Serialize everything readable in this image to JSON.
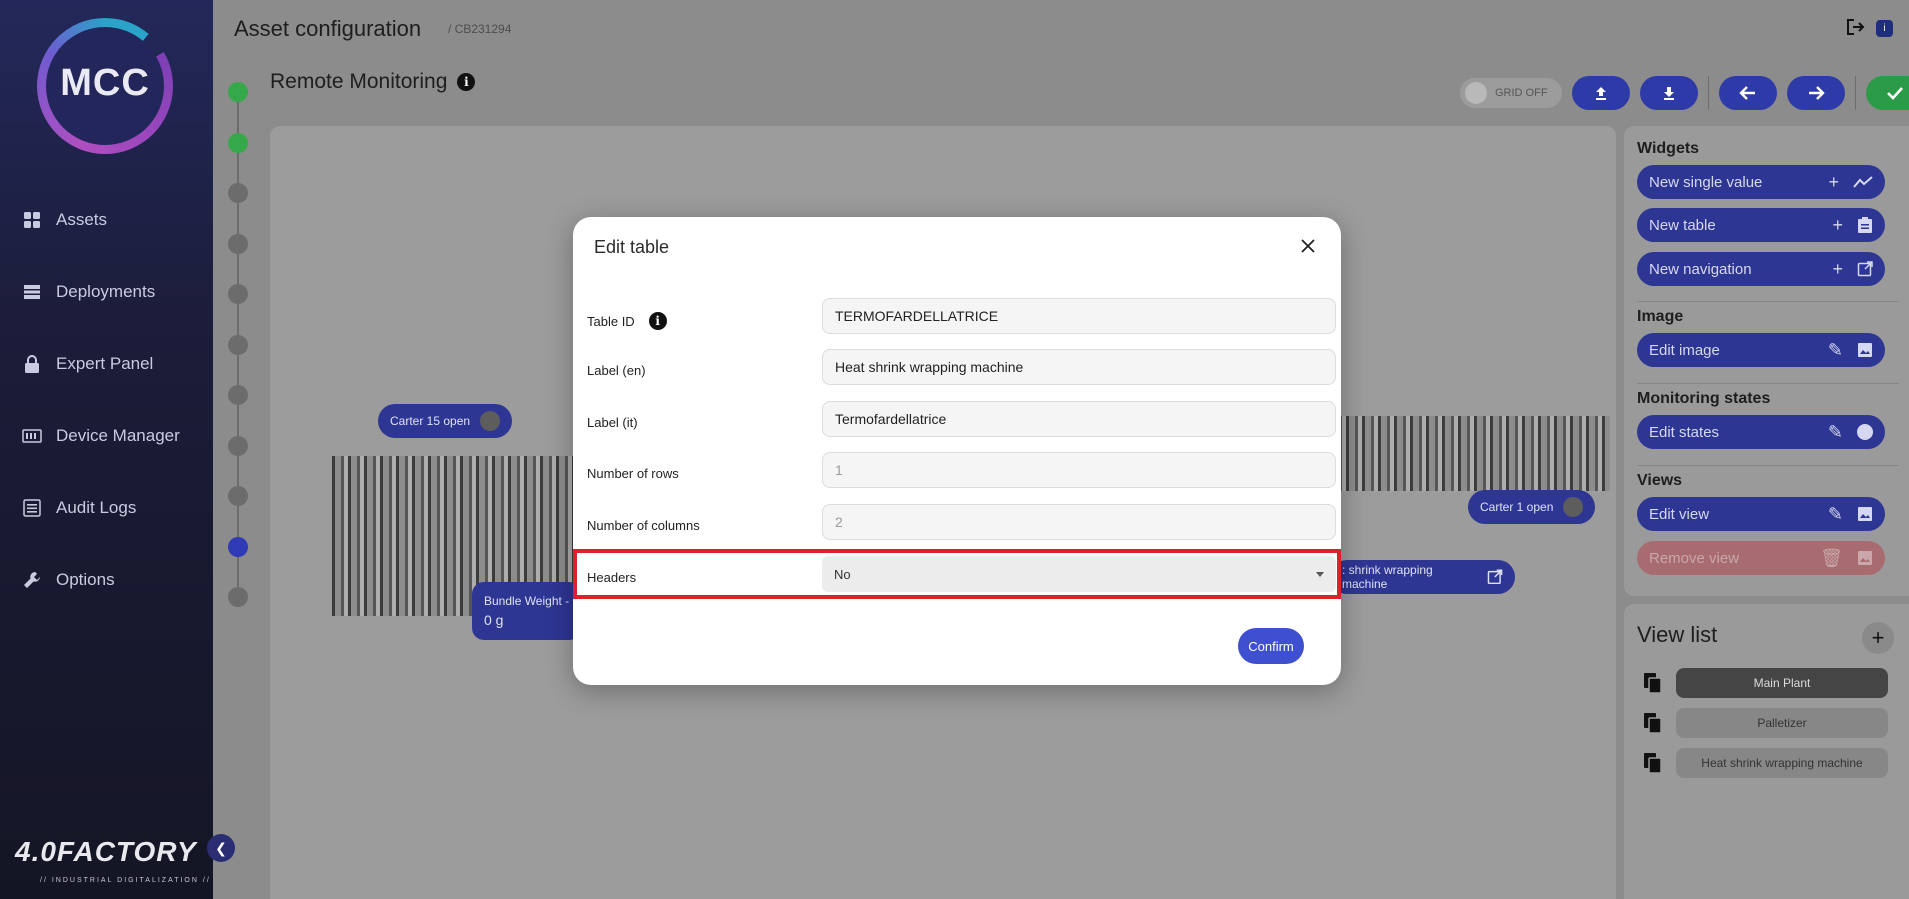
{
  "sidebar": {
    "logo": "MCC",
    "items": [
      {
        "label": "Assets",
        "icon": "grid-icon"
      },
      {
        "label": "Deployments",
        "icon": "server-icon"
      },
      {
        "label": "Expert Panel",
        "icon": "lock-icon"
      },
      {
        "label": "Device Manager",
        "icon": "device-icon"
      },
      {
        "label": "Audit Logs",
        "icon": "list-icon"
      },
      {
        "label": "Options",
        "icon": "wrench-icon"
      }
    ],
    "brand": "4.0FACTORY",
    "brand_sub": "// INDUSTRIAL DIGITALIZATION //"
  },
  "header": {
    "title": "Asset configuration",
    "asset_id": "/ CB231294"
  },
  "section": {
    "title": "Remote Monitoring"
  },
  "toolbar": {
    "grid_label": "GRID OFF"
  },
  "canvas": {
    "tags": {
      "carter15": "Carter 15 open",
      "carter1": "Carter 1 open",
      "bundle_weight": "Bundle Weight -",
      "bundle_value": "0 g",
      "heat_nav": ": shrink wrapping machine"
    }
  },
  "right_panel": {
    "widgets_title": "Widgets",
    "new_single_value": "New single value",
    "new_table": "New table",
    "new_navigation": "New navigation",
    "image_title": "Image",
    "edit_image": "Edit image",
    "monitoring_title": "Monitoring states",
    "edit_states": "Edit states",
    "views_title": "Views",
    "edit_view": "Edit view",
    "remove_view": "Remove view"
  },
  "view_list": {
    "title": "View list",
    "items": [
      "Main Plant",
      "Palletizer",
      "Heat shrink wrapping machine"
    ],
    "selected": "Main Plant"
  },
  "modal": {
    "title": "Edit table",
    "fields": {
      "table_id_label": "Table ID",
      "table_id_value": "TERMOFARDELLATRICE",
      "label_en_label": "Label (en)",
      "label_en_value": "Heat shrink wrapping machine",
      "label_it_label": "Label (it)",
      "label_it_value": "Termofardellatrice",
      "rows_label": "Number of rows",
      "rows_value": "1",
      "cols_label": "Number of columns",
      "cols_value": "2",
      "headers_label": "Headers",
      "headers_value": "No"
    },
    "confirm_label": "Confirm"
  },
  "colors": {
    "accent": "#3e4fcf",
    "highlight": "#d8232a",
    "success": "#35a84a"
  }
}
